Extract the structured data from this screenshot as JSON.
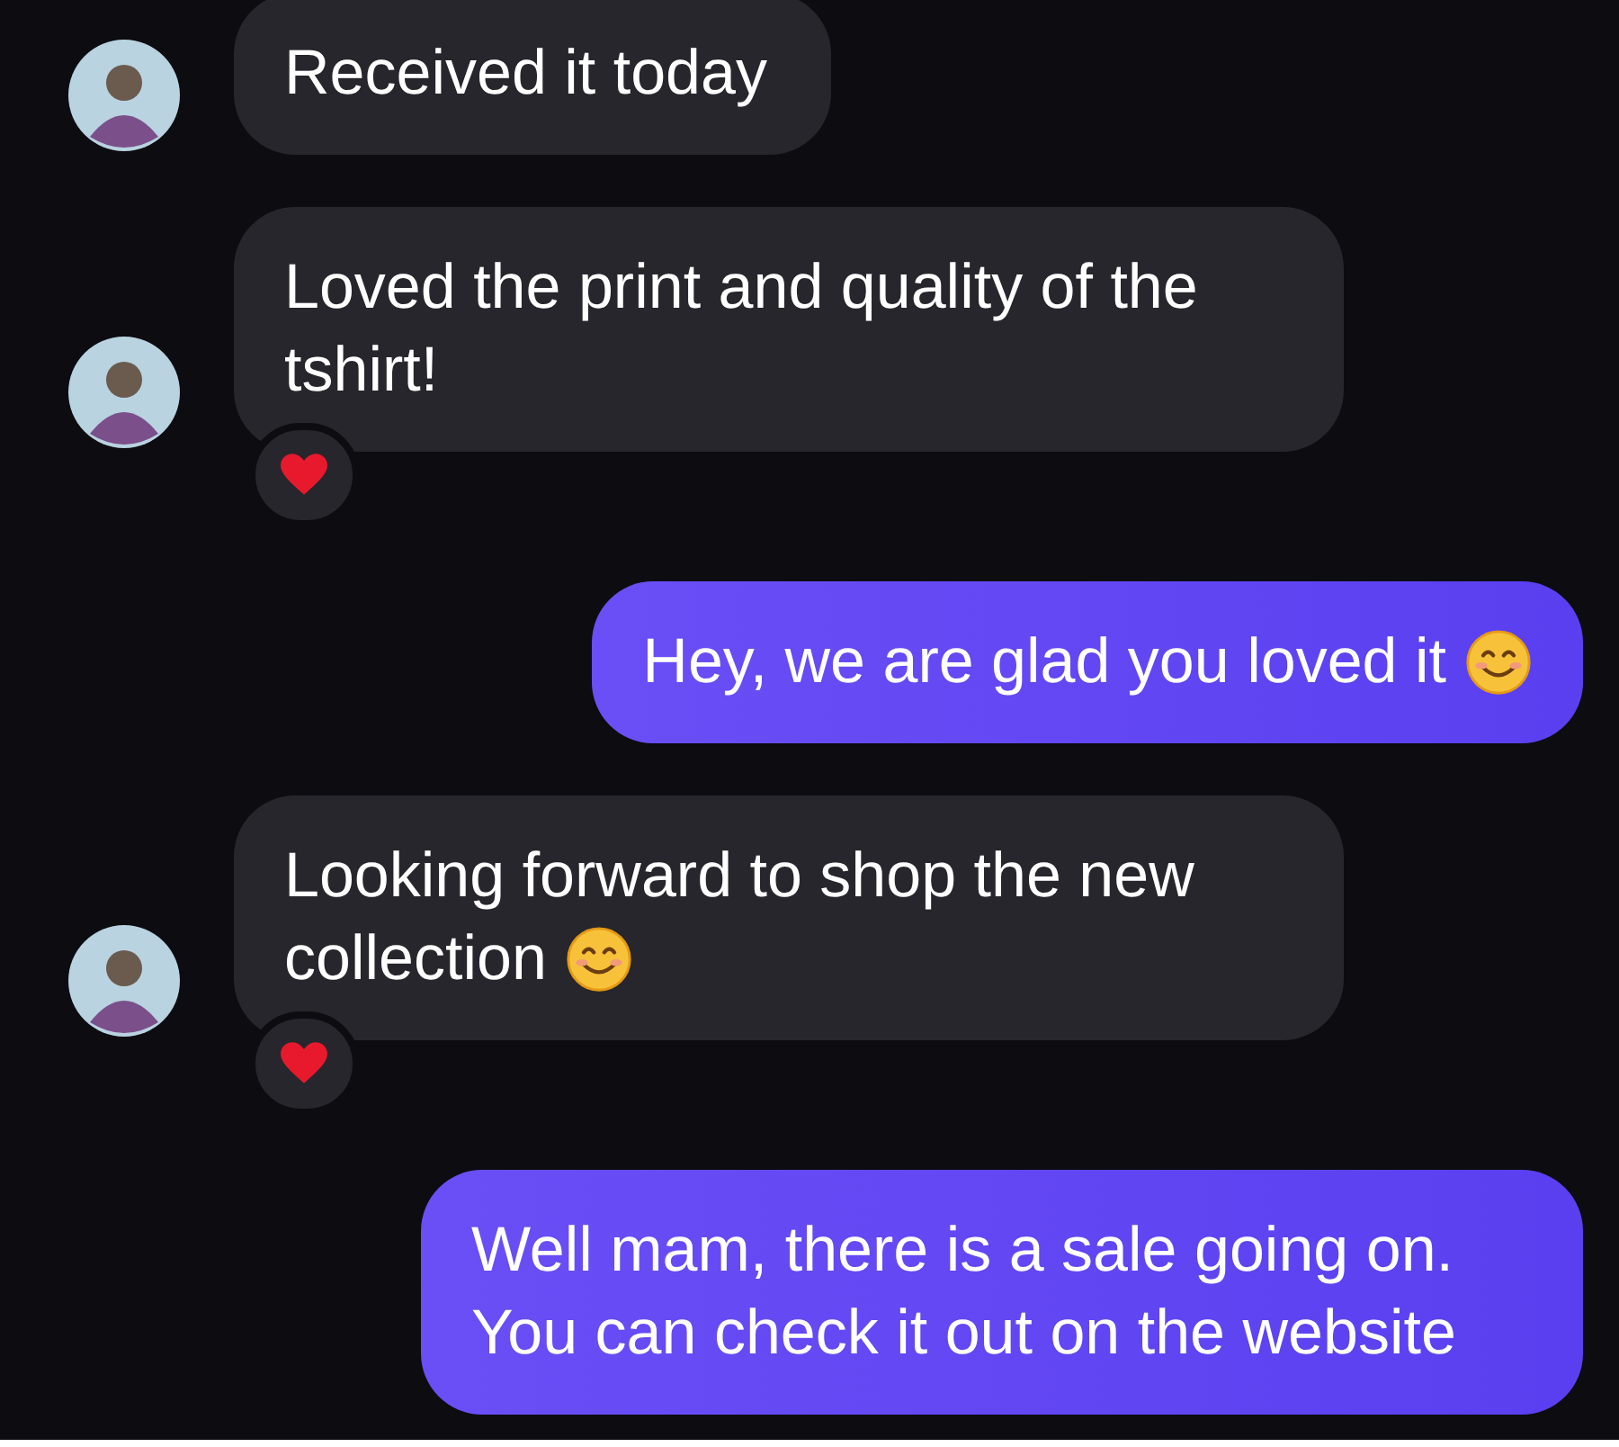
{
  "messages": [
    {
      "kind": "incoming",
      "text": "Received it today",
      "smiley": false,
      "reaction": false
    },
    {
      "kind": "incoming",
      "text": "Loved the print and quality of the tshirt!",
      "smiley": false,
      "reaction": true
    },
    {
      "kind": "outgoing",
      "text": "Hey, we are glad you loved it",
      "smiley": true,
      "reaction": false
    },
    {
      "kind": "incoming",
      "text": "Looking forward to shop the new collection",
      "smiley": true,
      "reaction": true
    },
    {
      "kind": "outgoing",
      "text": "Well mam, there is a sale going on. You can check it out on the website",
      "smiley": false,
      "reaction": false
    }
  ]
}
